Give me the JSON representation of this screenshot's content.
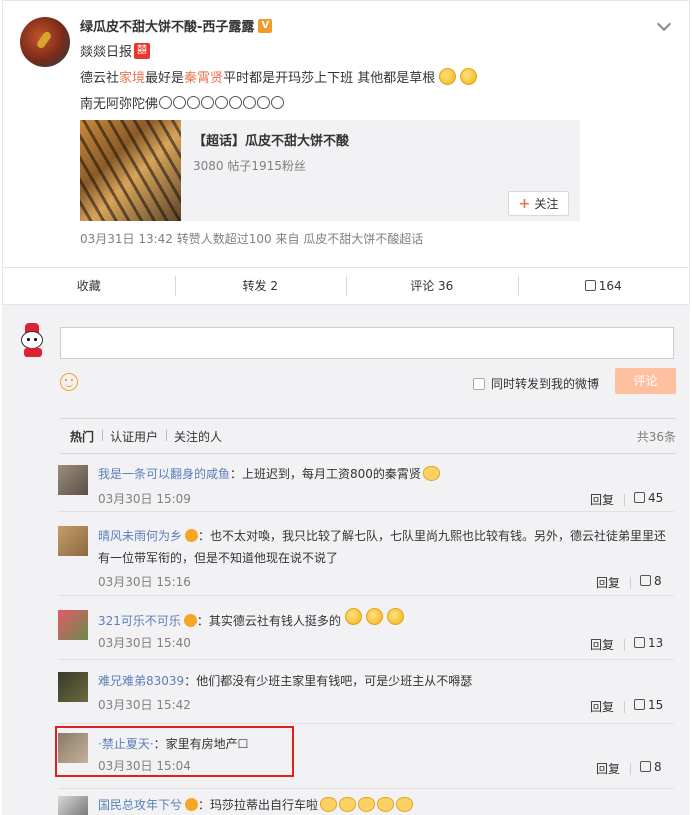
{
  "post": {
    "author": "绿瓜皮不甜大饼不酸-西子露露",
    "verified_badge": "V",
    "line1_text": "燚燚日报",
    "line1_emoji": "囍",
    "line2_prefix": "德云社",
    "line2_link1": "家境",
    "line2_mid": "最好是",
    "line2_link2": "秦霄贤",
    "line2_suffix": " 平时都是开玛莎上下班 其他都是草根",
    "line3_text": "南无阿弥陀佛",
    "topic_title": "【超话】瓜皮不甜大饼不酸",
    "topic_stats": "3080 帖子1915粉丝",
    "follow_label": "关注",
    "meta": "03月31日 13:42 转赞人数超过100  来自 瓜皮不甜大饼不酸超话"
  },
  "actions": {
    "collect": "收藏",
    "repost": "转发 2",
    "comment": "评论 36",
    "like": "164"
  },
  "composer": {
    "repost_label": "同时转发到我的微博",
    "submit": "评论"
  },
  "tabs": {
    "hot": "热门",
    "verified": "认证用户",
    "following": "关注的人",
    "total": "共36条"
  },
  "comments": [
    {
      "user": "我是一条可以翻身的咸鱼",
      "text": "：上班迟到，每月工资800的秦霄贤",
      "time": "03月30日 15:09",
      "reply": "回复",
      "likes": "45"
    },
    {
      "user": "晴风未雨何为乡",
      "text": "：也不太对喚，我只比较了解七队，七队里尚九熙也比较有钱。另外，德云社徒弟里里还有一位带军衔的，但是不知道他现在说不说了",
      "time": "03月30日 15:16",
      "reply": "回复",
      "likes": "8"
    },
    {
      "user": "321可乐不可乐",
      "text": "：其实德云社有钱人挺多的",
      "time": "03月30日 15:40",
      "reply": "回复",
      "likes": "13"
    },
    {
      "user": "难兄难弟83039",
      "text": "：他们都没有少班主家里有钱吧，可是少班主从不嘚瑟",
      "time": "03月30日 15:42",
      "reply": "回复",
      "likes": "15"
    },
    {
      "user": "·禁止夏天·",
      "text": "：家里有房地产☐",
      "time": "03月30日 15:04",
      "reply": "回复",
      "likes": "8"
    },
    {
      "user": "国民总攻年下兮",
      "text": "：玛莎拉蒂出自行车啦"
    }
  ]
}
